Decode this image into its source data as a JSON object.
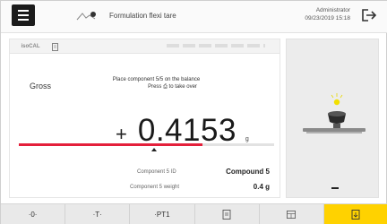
{
  "header": {
    "title": "Formulation flexi tare",
    "user": "Administrator",
    "datetime": "09/23/2019 15:18",
    "menu_icon": "hamburger-icon",
    "logout_icon": "logout-icon"
  },
  "tabs": [
    {
      "label": "isoCAL"
    },
    {
      "label": "",
      "icon": "document-icon"
    }
  ],
  "main": {
    "mode_label": "Gross",
    "instruction_line1": "Place component 5/5 on the balance",
    "instruction_line2": "Press ⎙ to take over",
    "sign": "+",
    "weight": "0.4153",
    "unit": "g",
    "progress": 0.72,
    "progress_color": "#e4203b",
    "component_id_label": "Component 5 ID",
    "component_id_value": "Compound 5",
    "component_weight_label": "Component 5 weight",
    "component_weight_value": "0.4 g"
  },
  "bottom_bar": {
    "zero_label": "·0·",
    "tare_label": "·T·",
    "pt_label": "·PT1",
    "active_color": "#ffd200"
  }
}
